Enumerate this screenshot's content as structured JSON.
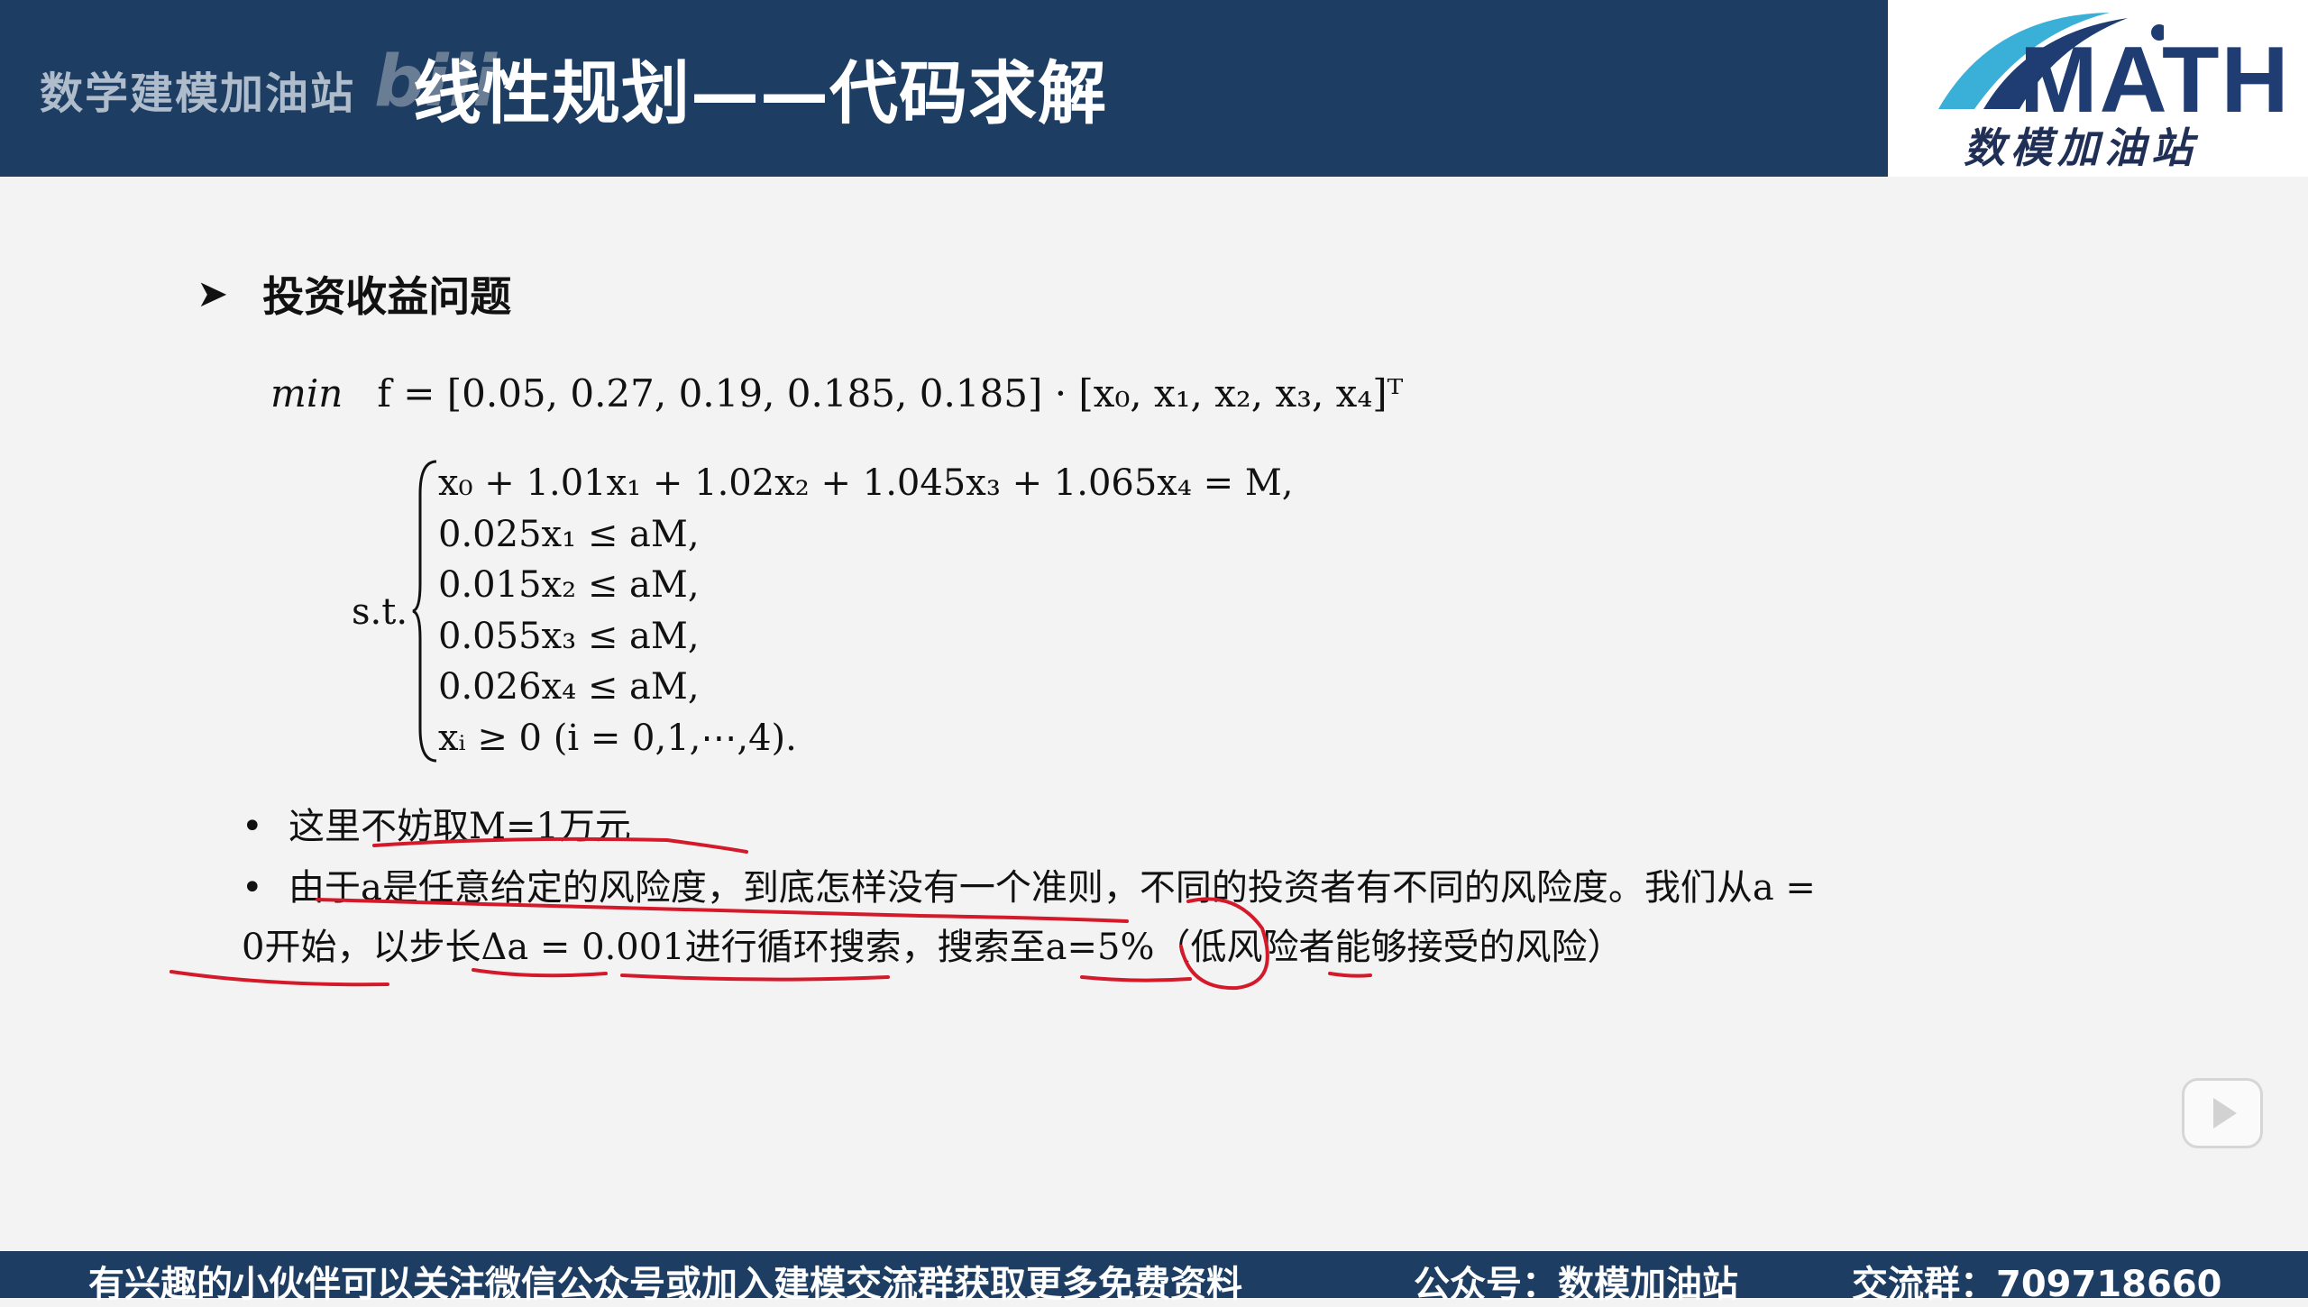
{
  "header": {
    "watermark": "数学建模加油站",
    "bili": "bili",
    "title": "线性规划——代码求解"
  },
  "logo": {
    "math": "MATH",
    "cn": "数模加油站"
  },
  "section": {
    "title": "投资收益问题"
  },
  "objective": {
    "keyword": "min",
    "expr": "f = [0.05,  0.27,  0.19,  0.185,  0.185] · [x₀, x₁, x₂, x₃, x₄]ᵀ"
  },
  "st_label": "s.t.",
  "constraints": [
    "x₀ + 1.01x₁ + 1.02x₂ + 1.045x₃ + 1.065x₄ = M,",
    "0.025x₁ ≤ aM,",
    "0.015x₂ ≤ aM,",
    "0.055x₃ ≤ aM,",
    "0.026x₄ ≤ aM,",
    "xᵢ ≥ 0  (i = 0,1,⋯,4)."
  ],
  "notes": {
    "note1": "这里不妨取M=1万元",
    "note2_line1": "由于a是任意给定的风险度，到底怎样没有一个准则，不同的投资者有不同的风险度。我们从a =",
    "note2_line2": "0开始，以步长Δa = 0.001进行循环搜索，搜索至a=5%（低风险者能够接受的风险）"
  },
  "footer": {
    "promo": "有兴趣的小伙伴可以关注微信公众号或加入建模交流群获取更多免费资料",
    "account": "公众号：数模加油站",
    "group": "交流群：709718660"
  },
  "colors": {
    "header_bg": "#1d3d62",
    "annotation": "#d41a2a",
    "logo_blue": "#1f3d72",
    "logo_cyan": "#3ab0d8"
  }
}
